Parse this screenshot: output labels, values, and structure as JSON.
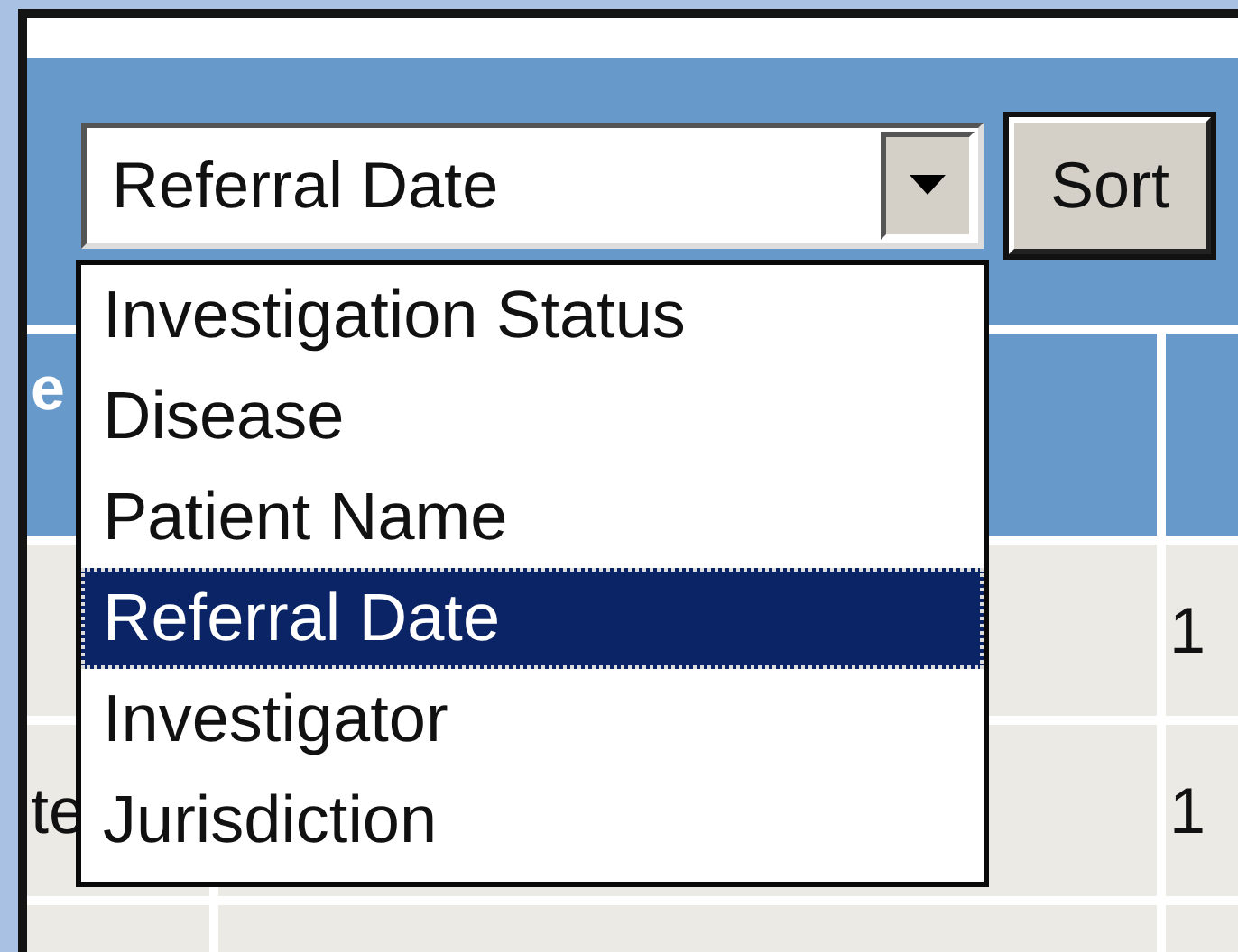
{
  "sort_bar": {
    "select": {
      "value": "Referral Date",
      "expanded": true
    },
    "button": "Sort"
  },
  "dropdown_options": [
    {
      "label": "Investigation Status",
      "selected": false
    },
    {
      "label": "Disease",
      "selected": false
    },
    {
      "label": "Patient Name",
      "selected": false
    },
    {
      "label": "Referral Date",
      "selected": true
    },
    {
      "label": "Investigator",
      "selected": false
    },
    {
      "label": "Jurisdiction",
      "selected": false
    }
  ],
  "table": {
    "header": {
      "column_1": "e"
    },
    "rows": [
      {
        "column_3": "1"
      },
      {
        "column_1": "te",
        "column_3": "1"
      },
      {}
    ]
  }
}
